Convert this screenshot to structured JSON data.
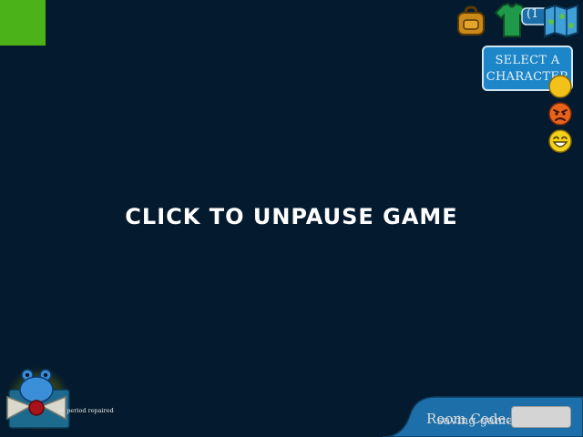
{
  "pause_overlay": {
    "message": "CLICK TO UNPAUSE GAME"
  },
  "toolbar": {
    "icons": [
      "backpack-icon",
      "shirt-icon",
      "clock-icon",
      "map-icon"
    ],
    "clock_partial_text": "(1"
  },
  "select_character": {
    "label_line1": "SELECT A",
    "label_line2": "CHARACTER"
  },
  "emotes": [
    "happy-emote-icon",
    "angry-emote-icon",
    "laughing-emote-icon"
  ],
  "player": {
    "avatar": "frog-bowtie-avatar",
    "status_text": "se period repaired"
  },
  "room": {
    "label": "Room Code:",
    "saving_text": "saving game",
    "code_value": ""
  },
  "colors": {
    "background": "#041a2e",
    "corner_square": "#4cb21a",
    "button_blue": "#1c86c8",
    "room_panel": "#1c6fa8"
  }
}
